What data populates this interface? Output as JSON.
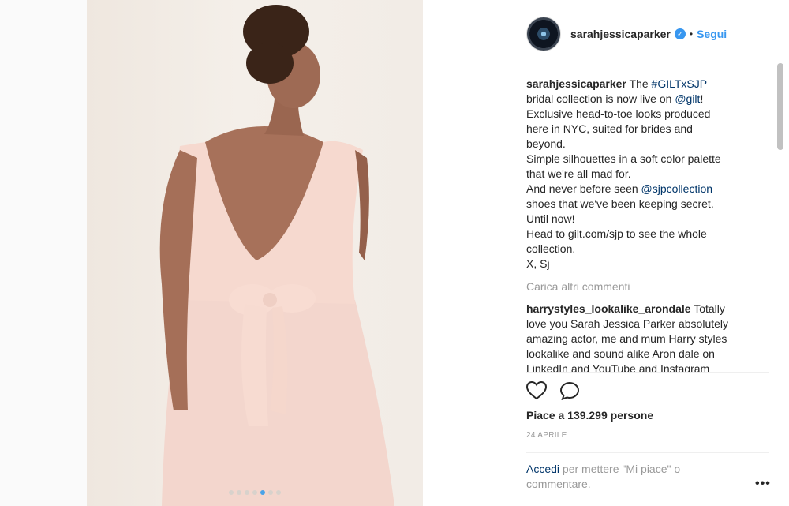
{
  "post": {
    "username": "sarahjessicaparker",
    "separator": "•",
    "follow_label": "Segui",
    "caption": {
      "lines": [
        {
          "parts": [
            {
              "t": "user",
              "v": "sarahjessicaparker"
            },
            {
              "t": "text",
              "v": " The "
            },
            {
              "t": "tag",
              "v": "#GILTxSJP"
            }
          ]
        },
        {
          "parts": [
            {
              "t": "text",
              "v": "bridal collection is now live on "
            },
            {
              "t": "tag",
              "v": "@gilt"
            },
            {
              "t": "text",
              "v": "!"
            }
          ]
        },
        {
          "parts": [
            {
              "t": "text",
              "v": "Exclusive head-to-toe looks produced"
            }
          ]
        },
        {
          "parts": [
            {
              "t": "text",
              "v": "here in NYC, suited for brides and"
            }
          ]
        },
        {
          "parts": [
            {
              "t": "text",
              "v": "beyond."
            }
          ]
        },
        {
          "parts": [
            {
              "t": "text",
              "v": "Simple silhouettes in a soft color palette"
            }
          ]
        },
        {
          "parts": [
            {
              "t": "text",
              "v": "that we're all mad for."
            }
          ]
        },
        {
          "parts": [
            {
              "t": "text",
              "v": "And never before seen "
            },
            {
              "t": "tag",
              "v": "@sjpcollection"
            }
          ]
        },
        {
          "parts": [
            {
              "t": "text",
              "v": "shoes that we've been keeping secret."
            }
          ]
        },
        {
          "parts": [
            {
              "t": "text",
              "v": "Until now!"
            }
          ]
        },
        {
          "parts": [
            {
              "t": "text",
              "v": "Head to gilt.com/sjp to see the whole"
            }
          ]
        },
        {
          "parts": [
            {
              "t": "text",
              "v": "collection."
            }
          ]
        },
        {
          "parts": [
            {
              "t": "text",
              "v": "X, Sj"
            }
          ]
        }
      ]
    },
    "load_more_comments": "Carica altri commenti",
    "comment": {
      "lines": [
        {
          "parts": [
            {
              "t": "user",
              "v": "harrystyles_lookalike_arondale"
            },
            {
              "t": "text",
              "v": " Totally"
            }
          ]
        },
        {
          "parts": [
            {
              "t": "text",
              "v": "love you Sarah Jessica Parker absolutely"
            }
          ]
        },
        {
          "parts": [
            {
              "t": "text",
              "v": "amazing actor, me and mum Harry styles"
            }
          ]
        },
        {
          "parts": [
            {
              "t": "text",
              "v": "lookalike and sound alike Aron dale on"
            }
          ]
        },
        {
          "parts": [
            {
              "t": "text",
              "v": "LinkedIn and YouTube and Instagram"
            }
          ]
        }
      ]
    },
    "likes_text": "Piace a 139.299 persone",
    "date": "24 APRILE",
    "login_link": "Accedi",
    "login_text": " per mettere \"Mi piace\" o commentare.",
    "more_options": "•••"
  },
  "carousel": {
    "count": 7,
    "active_index": 4
  },
  "colors": {
    "link": "#3897f0",
    "tag": "#003569",
    "muted": "#999999",
    "text": "#262626"
  }
}
